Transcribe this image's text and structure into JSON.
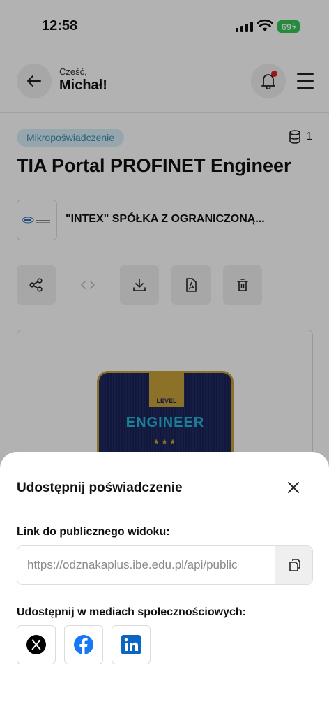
{
  "status_bar": {
    "time": "12:58",
    "battery": "69"
  },
  "header": {
    "greeting": "Cześć,",
    "user_name": "Michał!"
  },
  "credential": {
    "type_badge": "Mikropoświadczenie",
    "count": "1",
    "title": "TIA Portal PROFINET Engineer",
    "issuer": "\"INTEX\" SPÓŁKA Z OGRANICZONĄ..."
  },
  "badge_image": {
    "ribbon_text": "LEVEL",
    "level_text": "ENGINEER",
    "stars": "★★★"
  },
  "share_sheet": {
    "title": "Udostępnij poświadczenie",
    "link_label": "Link do publicznego widoku:",
    "link_value": "https://odznakaplus.ibe.edu.pl/api/public",
    "social_label": "Udostępnij w mediach społecznościowych:",
    "socials": [
      {
        "icon": "x-icon",
        "color": "#000000"
      },
      {
        "icon": "facebook-icon",
        "color": "#1877f2"
      },
      {
        "icon": "linkedin-icon",
        "color": "#0a66c2"
      }
    ]
  }
}
